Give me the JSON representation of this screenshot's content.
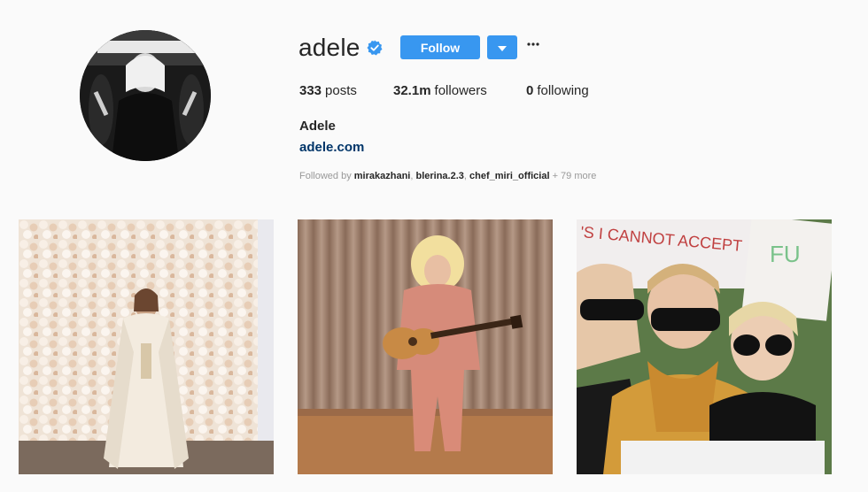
{
  "profile": {
    "username": "adele",
    "full_name": "Adele",
    "website": "adele.com",
    "verified_icon": "verified-badge",
    "follow_label": "Follow",
    "stats": {
      "posts_count": "333",
      "posts_label": "posts",
      "followers_count": "32.1m",
      "followers_label": "followers",
      "following_count": "0",
      "following_label": "following"
    },
    "followed_by": {
      "prefix": "Followed by",
      "user1": "mirakazhani",
      "user2": "blerina.2.3",
      "user3": "chef_miri_official",
      "suffix": "+ 79 more"
    }
  },
  "colors": {
    "accent": "#3897f0",
    "link": "#003569",
    "background": "#fafafa"
  },
  "icons": {
    "verified": "verified-icon",
    "dropdown": "chevron-down-icon",
    "more": "more-options-icon"
  }
}
